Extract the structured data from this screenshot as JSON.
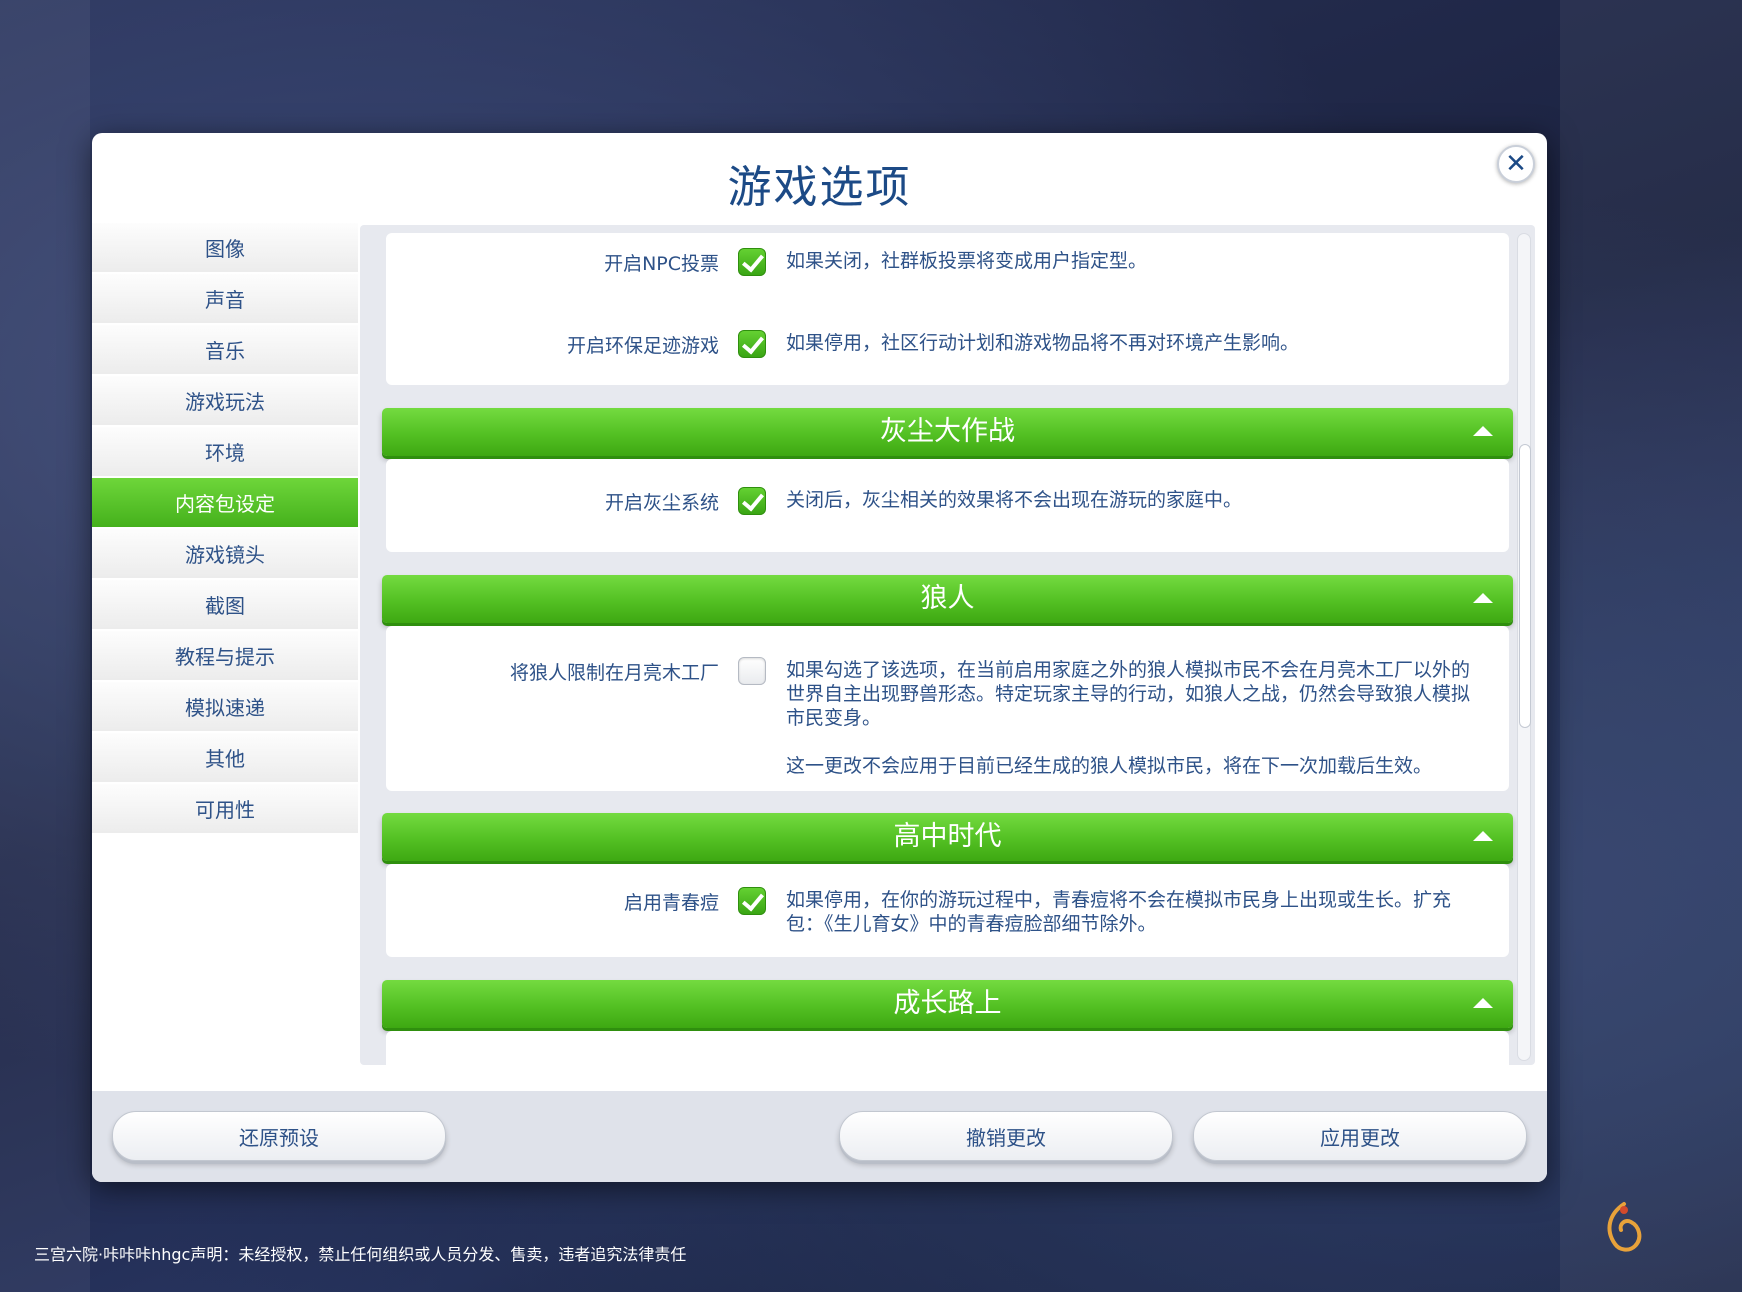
{
  "dialog": {
    "title": "游戏选项",
    "close_symbol": "✕"
  },
  "sidebar": {
    "items": [
      {
        "label": "图像"
      },
      {
        "label": "声音"
      },
      {
        "label": "音乐"
      },
      {
        "label": "游戏玩法"
      },
      {
        "label": "环境"
      },
      {
        "label": "内容包设定",
        "active": true
      },
      {
        "label": "游戏镜头"
      },
      {
        "label": "截图"
      },
      {
        "label": "教程与提示"
      },
      {
        "label": "模拟速递"
      },
      {
        "label": "其他"
      },
      {
        "label": "可用性"
      }
    ]
  },
  "options": {
    "npc_voting": {
      "label": "开启NPC投票",
      "checked": true,
      "desc": "如果关闭，社群板投票将变成用户指定型。"
    },
    "eco_footprint": {
      "label": "开启环保足迹游戏",
      "checked": true,
      "desc": "如果停用，社区行动计划和游戏物品将不再对环境产生影响。"
    },
    "dust_section": {
      "title": "灰尘大作战"
    },
    "dust_system": {
      "label": "开启灰尘系统",
      "checked": true,
      "desc": "关闭后，灰尘相关的效果将不会出现在游玩的家庭中。"
    },
    "werewolf_section": {
      "title": "狼人"
    },
    "werewolf_limit": {
      "label": "将狼人限制在月亮木工厂",
      "checked": false,
      "desc": "如果勾选了该选项，在当前启用家庭之外的狼人模拟市民不会在月亮木工厂以外的世界自主出现野兽形态。特定玩家主导的行动，如狼人之战，仍然会导致狼人模拟市民变身。",
      "desc2": "这一更改不会应用于目前已经生成的狼人模拟市民，将在下一次加载后生效。"
    },
    "highschool_section": {
      "title": "高中时代"
    },
    "acne": {
      "label": "启用青春痘",
      "checked": true,
      "desc": "如果停用，在你的游玩过程中，青春痘将不会在模拟市民身上出现或生长。扩充包：《生儿育女》中的青春痘脸部细节除外。"
    },
    "growing_section": {
      "title": "成长路上"
    }
  },
  "footer": {
    "restore_label": "还原预设",
    "undo_label": "撤销更改",
    "apply_label": "应用更改"
  },
  "watermark": {
    "disclaimer": "三宫六院·咔咔咔hhgc声明：未经授权，禁止任何组织或人员分发、售卖，违者追究法律责任"
  },
  "colors": {
    "accent_green": "#53c023",
    "text_blue": "#2e5288",
    "title_blue": "#1c4a86"
  }
}
